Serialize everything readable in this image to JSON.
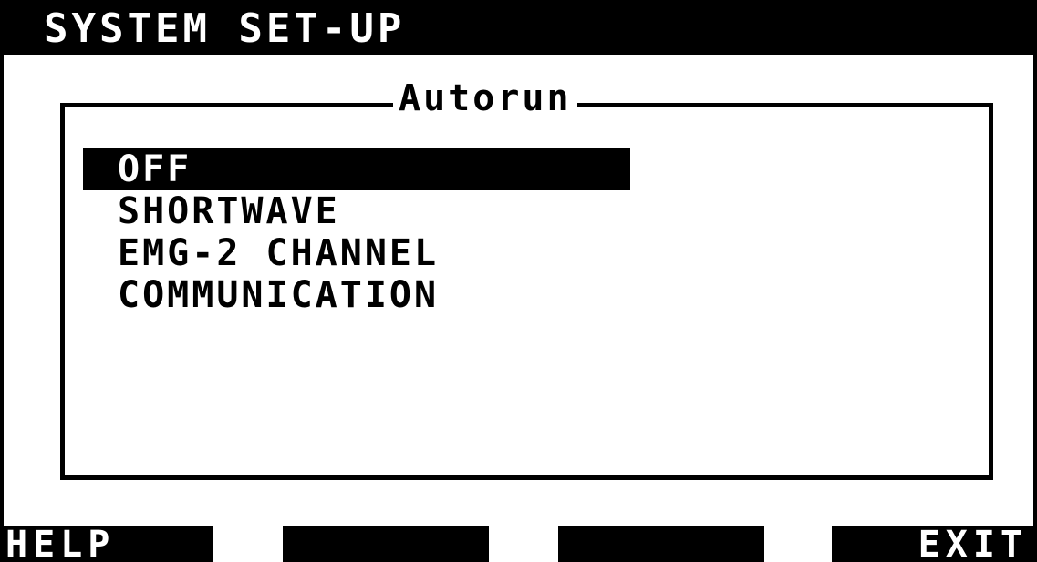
{
  "header": {
    "title": "SYSTEM SET-UP"
  },
  "panel": {
    "legend": "Autorun",
    "options": [
      {
        "label": "OFF",
        "selected": true
      },
      {
        "label": "SHORTWAVE",
        "selected": false
      },
      {
        "label": "EMG-2 CHANNEL",
        "selected": false
      },
      {
        "label": "COMMUNICATION",
        "selected": false
      }
    ]
  },
  "softkeys": {
    "f1": "HELP",
    "f2": "",
    "f3": "",
    "f4": "EXIT"
  },
  "colors": {
    "foreground": "#000000",
    "background": "#ffffff"
  }
}
